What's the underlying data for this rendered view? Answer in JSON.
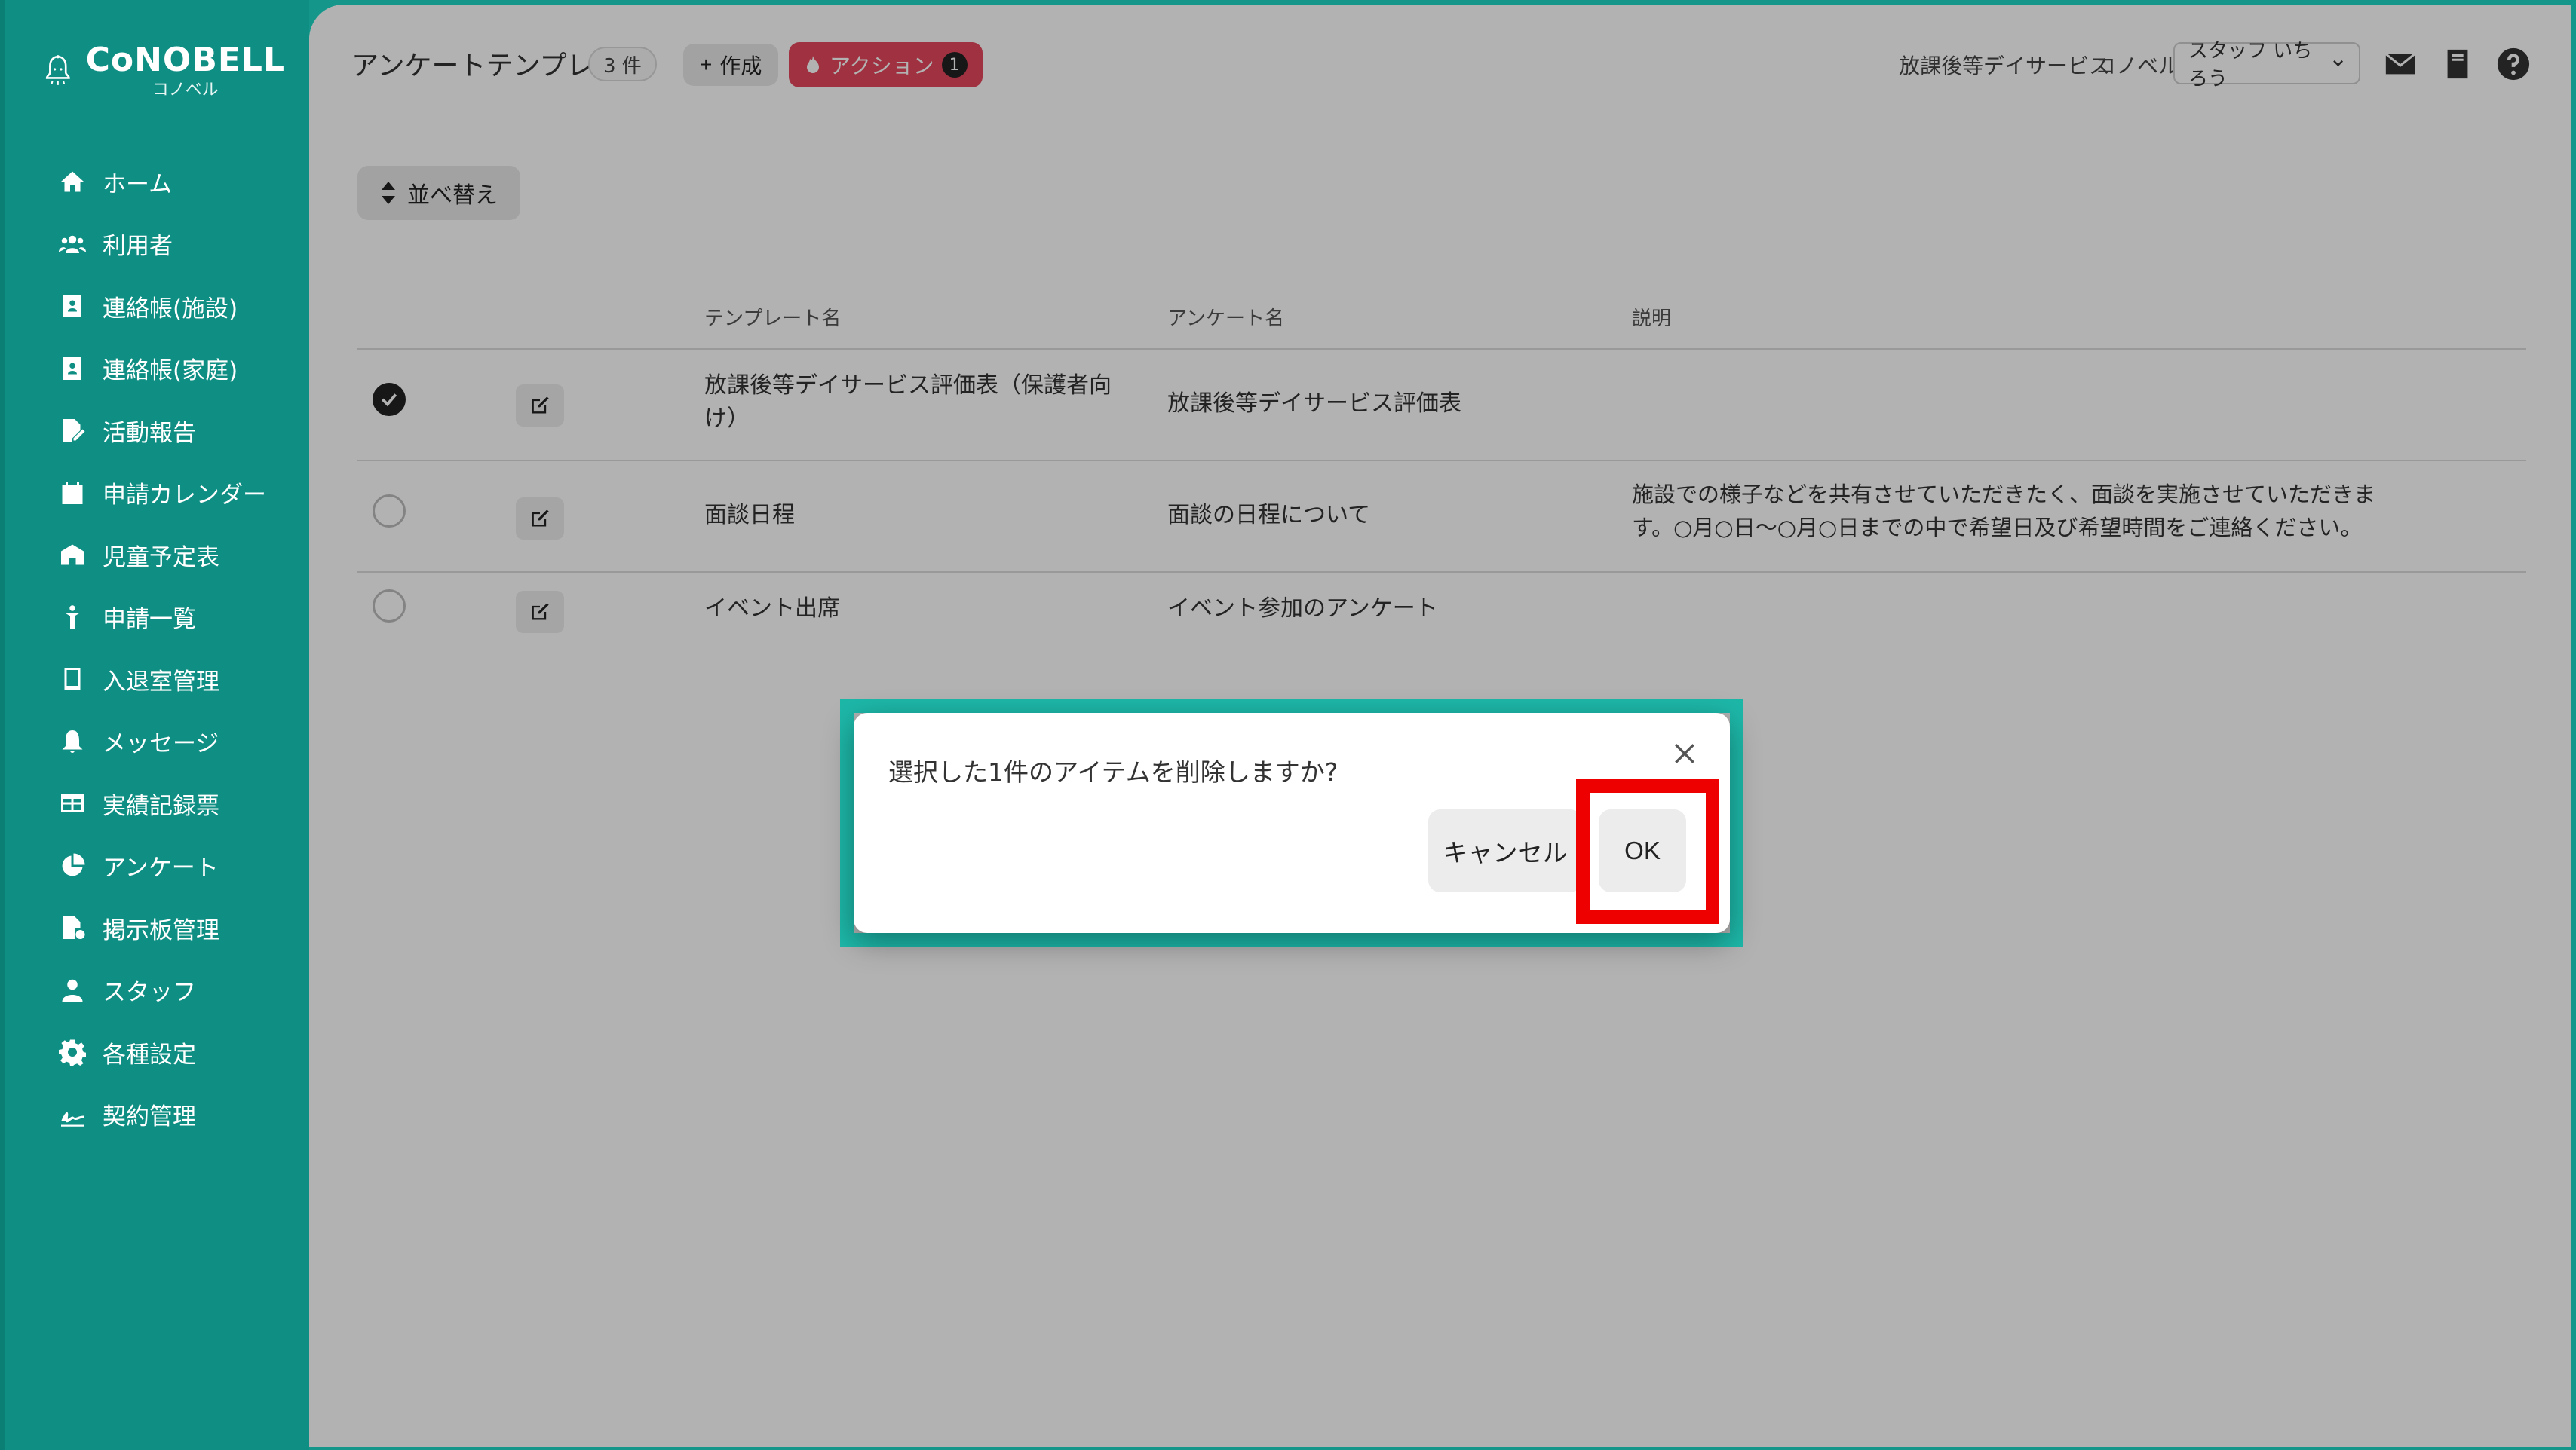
{
  "brand": {
    "name": "CoNOBELL",
    "sub": "コノベル"
  },
  "sidebar": {
    "items": [
      {
        "label": "ホーム",
        "icon": "home-icon"
      },
      {
        "label": "利用者",
        "icon": "users-icon"
      },
      {
        "label": "連絡帳(施設)",
        "icon": "contact-book-icon"
      },
      {
        "label": "連絡帳(家庭)",
        "icon": "contact-book-icon"
      },
      {
        "label": "活動報告",
        "icon": "file-edit-icon"
      },
      {
        "label": "申請カレンダー",
        "icon": "calendar-icon"
      },
      {
        "label": "児童予定表",
        "icon": "school-icon"
      },
      {
        "label": "申請一覧",
        "icon": "child-icon"
      },
      {
        "label": "入退室管理",
        "icon": "tablet-icon"
      },
      {
        "label": "メッセージ",
        "icon": "bell-icon"
      },
      {
        "label": "実績記録票",
        "icon": "table-icon"
      },
      {
        "label": "アンケート",
        "icon": "pie-chart-icon"
      },
      {
        "label": "掲示板管理",
        "icon": "file-settings-icon"
      },
      {
        "label": "スタッフ",
        "icon": "person-icon"
      },
      {
        "label": "各種設定",
        "icon": "gear-icon"
      },
      {
        "label": "契約管理",
        "icon": "signature-icon"
      }
    ]
  },
  "header": {
    "title": "アンケートテンプレート",
    "count": "3 件",
    "create_label": "作成",
    "action_label": "アクション",
    "action_count": "1",
    "facility": "放課後等デイサービス",
    "org": "コノベル",
    "staff": "スタッフ いちろう"
  },
  "toolbar": {
    "sort_label": "並べ替え"
  },
  "table": {
    "columns": [
      "テンプレート名",
      "アンケート名",
      "説明"
    ],
    "rows": [
      {
        "checked": true,
        "template": "放課後等デイサービス評価表（保護者向け）",
        "survey": "放課後等デイサービス評価表",
        "desc": ""
      },
      {
        "checked": false,
        "template": "面談日程",
        "survey": "面談の日程について",
        "desc": "施設での様子などを共有させていただきたく、面談を実施させていただきます。○月○日～○月○日までの中で希望日及び希望時間をご連絡ください。"
      },
      {
        "checked": false,
        "template": "イベント出席",
        "survey": "イベント参加のアンケート",
        "desc": ""
      }
    ]
  },
  "dialog": {
    "message": "選択した1件のアイテムを削除しますか?",
    "cancel_label": "キャンセル",
    "ok_label": "OK"
  },
  "colors": {
    "sidebar": "#0f8f84",
    "action": "#e6475c",
    "dialog_outline": "#1db7a8",
    "highlight": "#ef0000"
  }
}
